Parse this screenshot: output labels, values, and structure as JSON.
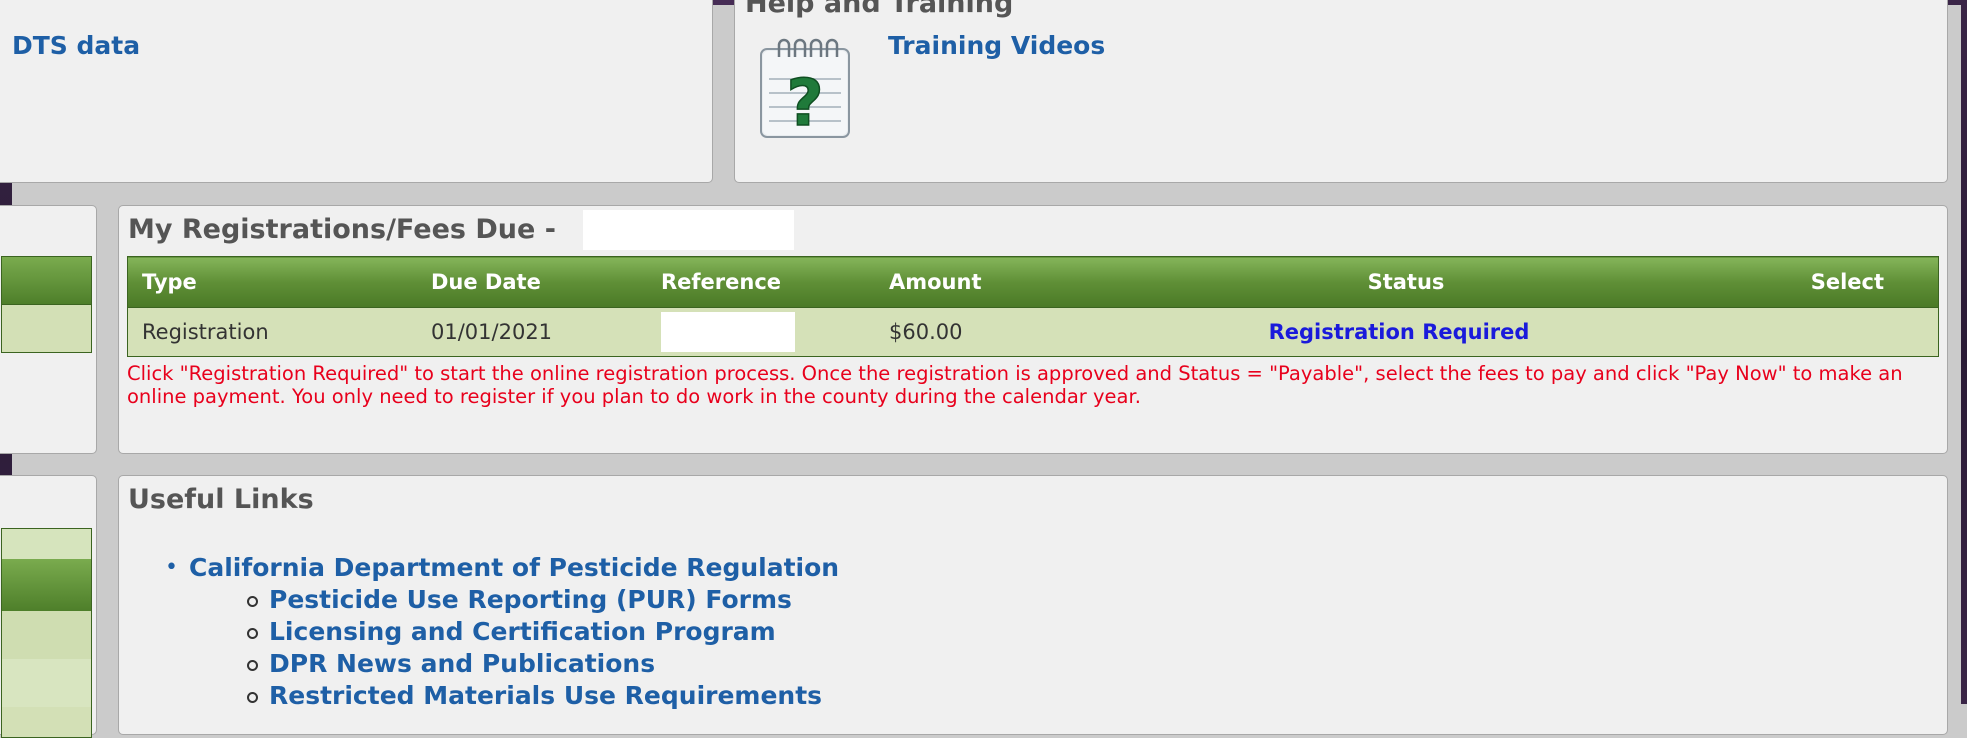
{
  "top_left_panel": {
    "link_text": "DTS data"
  },
  "help_panel": {
    "title": "Help and Training",
    "training_link": "Training Videos",
    "icon": "help-notepad-question-icon"
  },
  "registrations": {
    "title": "My Registrations/Fees Due -",
    "columns": [
      "Type",
      "Due Date",
      "Reference",
      "Amount",
      "Status",
      "Select"
    ],
    "rows": [
      {
        "type": "Registration",
        "due_date": "01/01/2021",
        "reference": "",
        "amount": "$60.00",
        "status": "Registration Required",
        "select": ""
      }
    ],
    "note": "Click \"Registration Required\" to start the online registration process. Once the registration is approved and Status = \"Payable\", select the fees to pay and click \"Pay Now\" to make an online payment. You only need to register if you plan to do work in the county during the calendar year."
  },
  "useful_links": {
    "title": "Useful Links",
    "items": [
      {
        "label": "California Department of Pesticide Regulation",
        "children": [
          "Pesticide Use Reporting (PUR) Forms",
          "Licensing and Certification Program",
          "DPR News and Publications",
          "Restricted Materials Use Requirements"
        ]
      }
    ]
  },
  "colors": {
    "header_green": "#5f8f36",
    "row_green": "#d5e1b8",
    "link_blue": "#1e5fa6",
    "status_blue": "#1a1adb",
    "note_red": "#e8001c"
  }
}
